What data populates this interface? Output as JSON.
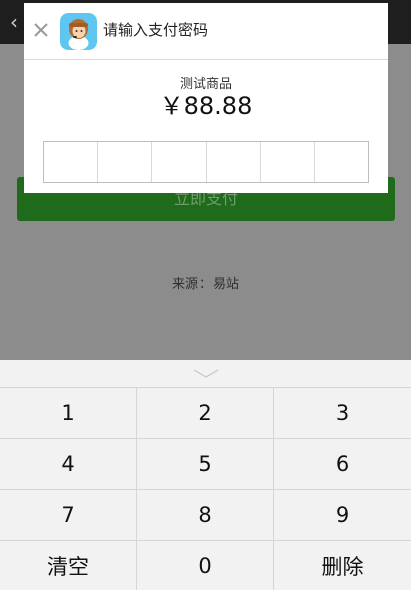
{
  "background": {
    "back_icon": "chevron-left-icon",
    "pay_button_label": "立即支付",
    "source_label": "来源",
    "source_separator": "：",
    "source_value": "易站"
  },
  "dialog": {
    "close_icon": "close-icon",
    "avatar_icon": "avatar-icon",
    "title": "请输入支付密码",
    "product_name": "测试商品",
    "amount": "￥88.88",
    "password_length": 6
  },
  "keyboard": {
    "collapse_icon": "chevron-down-icon",
    "keys": [
      [
        "1",
        "2",
        "3"
      ],
      [
        "4",
        "5",
        "6"
      ],
      [
        "7",
        "8",
        "9"
      ],
      [
        "清空",
        "0",
        "删除"
      ]
    ]
  }
}
